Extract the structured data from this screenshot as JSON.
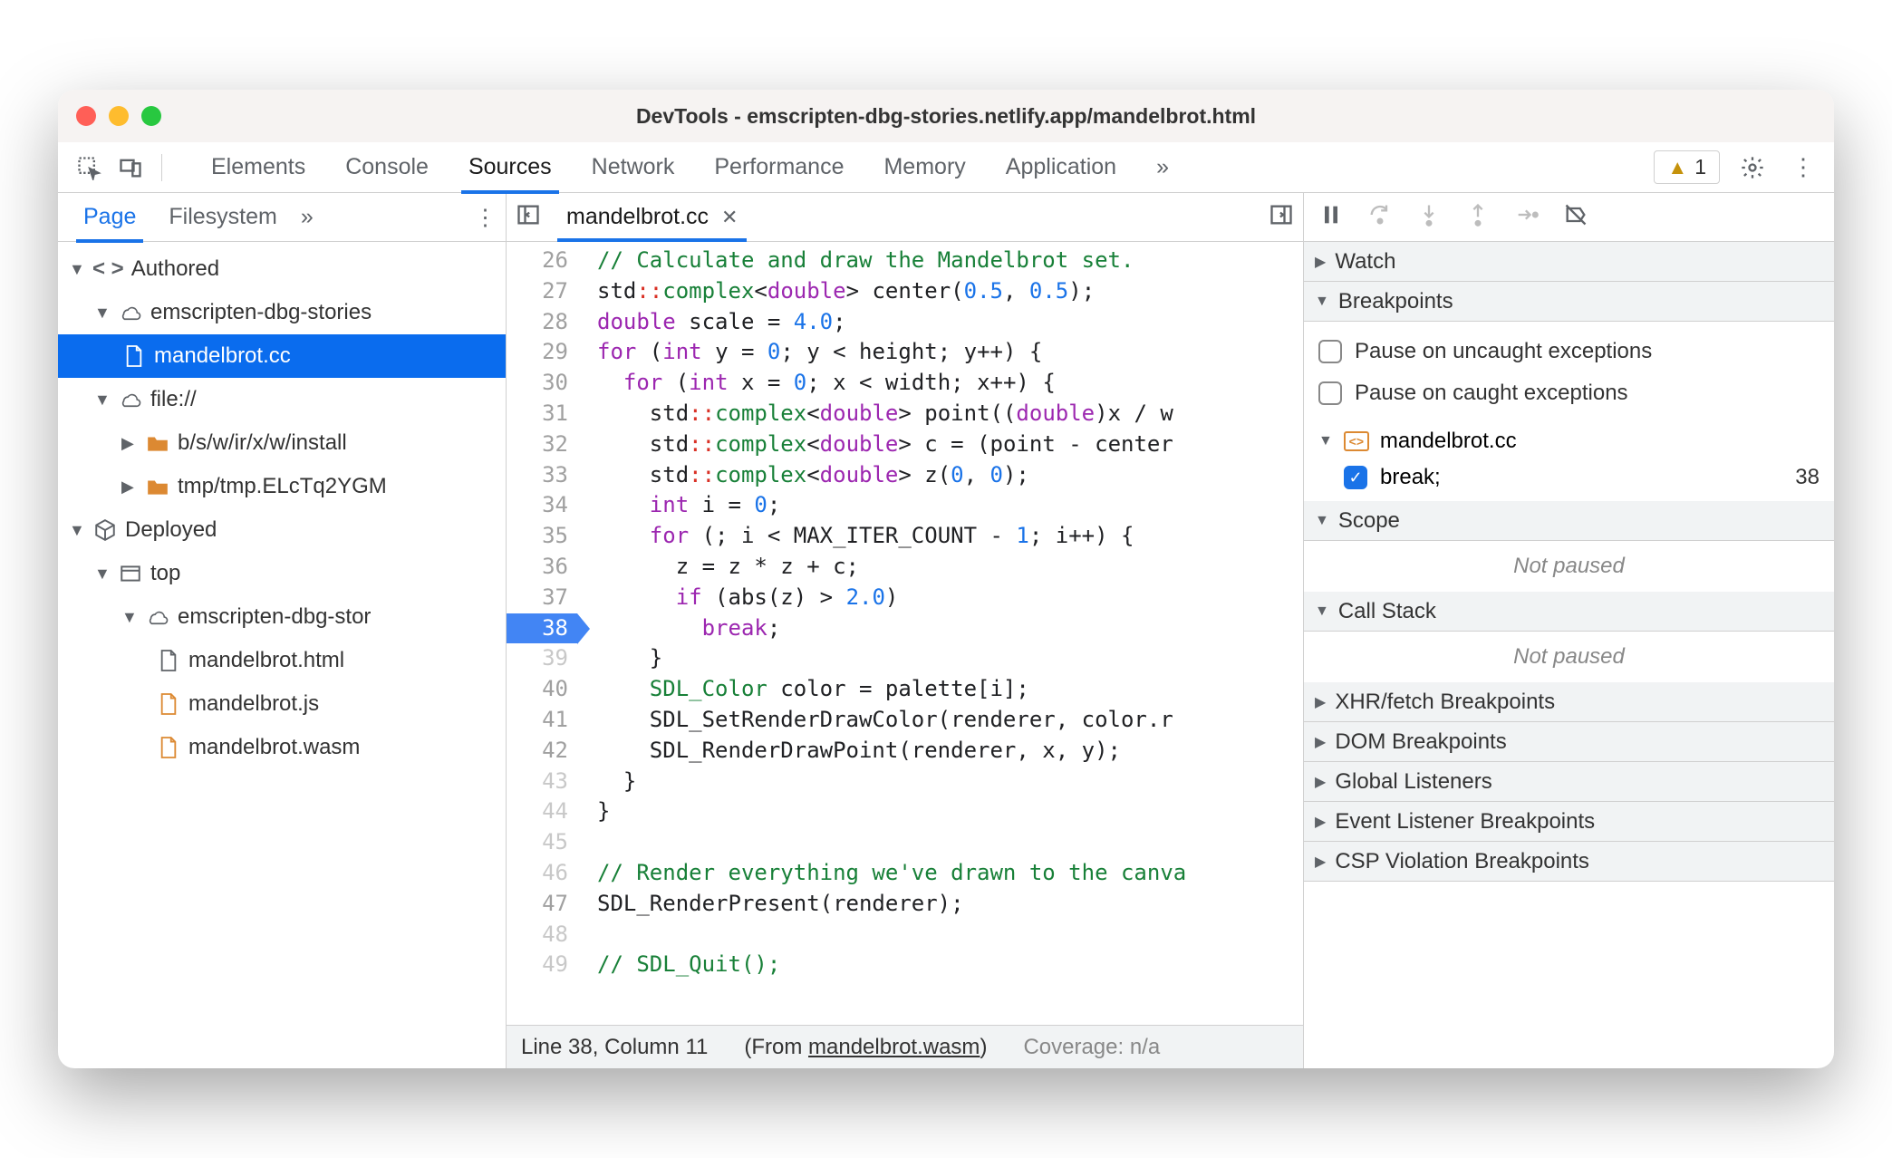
{
  "title": "DevTools - emscripten-dbg-stories.netlify.app/mandelbrot.html",
  "toolbar": {
    "tabs": [
      "Elements",
      "Console",
      "Sources",
      "Network",
      "Performance",
      "Memory",
      "Application"
    ],
    "active": "Sources",
    "overflow": "»",
    "warning_count": "1"
  },
  "nav": {
    "tabs": [
      "Page",
      "Filesystem"
    ],
    "active": "Page",
    "overflow": "»",
    "tree": {
      "authored": "Authored",
      "origin1": "emscripten-dbg-stories",
      "file_selected": "mandelbrot.cc",
      "file_scheme": "file://",
      "folder1": "b/s/w/ir/x/w/install",
      "folder2": "tmp/tmp.ELcTq2YGM",
      "deployed": "Deployed",
      "frame": "top",
      "origin2": "emscripten-dbg-stor",
      "f_html": "mandelbrot.html",
      "f_js": "mandelbrot.js",
      "f_wasm": "mandelbrot.wasm"
    }
  },
  "editor": {
    "tab_name": "mandelbrot.cc",
    "status_pos": "Line 38, Column 11",
    "status_from_prefix": "(From ",
    "status_from_link": "mandelbrot.wasm",
    "status_from_suffix": ")",
    "status_cov": "Coverage: n/a",
    "breakpoint_line": 38,
    "lines": [
      {
        "n": 26,
        "html": "<span class='c-comment'>// Calculate and draw the Mandelbrot set.</span>"
      },
      {
        "n": 27,
        "html": "std<span class='c-prop'>::</span><span class='c-type'>complex</span>&lt;<span class='c-keyword'>double</span>&gt; center(<span class='c-number'>0.5</span>, <span class='c-number'>0.5</span>);"
      },
      {
        "n": 28,
        "html": "<span class='c-keyword'>double</span> scale = <span class='c-number'>4.0</span>;"
      },
      {
        "n": 29,
        "html": "<span class='c-keyword'>for</span> (<span class='c-keyword'>int</span> y = <span class='c-number'>0</span>; y &lt; height; y++) {"
      },
      {
        "n": 30,
        "html": "  <span class='c-keyword'>for</span> (<span class='c-keyword'>int</span> x = <span class='c-number'>0</span>; x &lt; width; x++) {"
      },
      {
        "n": 31,
        "html": "    std<span class='c-prop'>::</span><span class='c-type'>complex</span>&lt;<span class='c-keyword'>double</span>&gt; point((<span class='c-keyword'>double</span>)x / w"
      },
      {
        "n": 32,
        "html": "    std<span class='c-prop'>::</span><span class='c-type'>complex</span>&lt;<span class='c-keyword'>double</span>&gt; c = (point - center"
      },
      {
        "n": 33,
        "html": "    std<span class='c-prop'>::</span><span class='c-type'>complex</span>&lt;<span class='c-keyword'>double</span>&gt; z(<span class='c-number'>0</span>, <span class='c-number'>0</span>);"
      },
      {
        "n": 34,
        "html": "    <span class='c-keyword'>int</span> i = <span class='c-number'>0</span>;"
      },
      {
        "n": 35,
        "html": "    <span class='c-keyword'>for</span> (; i &lt; MAX_ITER_COUNT - <span class='c-number'>1</span>; i++) {"
      },
      {
        "n": 36,
        "html": "      z = z * z + c;"
      },
      {
        "n": 37,
        "html": "      <span class='c-keyword'>if</span> (abs(z) &gt; <span class='c-number'>2.0</span>)"
      },
      {
        "n": 38,
        "html": "        <span class='c-break'>break</span>;"
      },
      {
        "n": 39,
        "html": "    }",
        "faded": true
      },
      {
        "n": 40,
        "html": "    <span class='c-type'>SDL_Color</span> color = palette[i];"
      },
      {
        "n": 41,
        "html": "    SDL_SetRenderDrawColor(renderer, color.r"
      },
      {
        "n": 42,
        "html": "    SDL_RenderDrawPoint(renderer, x, y);"
      },
      {
        "n": 43,
        "html": "  }",
        "faded": true
      },
      {
        "n": 44,
        "html": "}",
        "faded": true
      },
      {
        "n": 45,
        "html": "",
        "faded": true
      },
      {
        "n": 46,
        "html": "<span class='c-comment'>// Render everything we've drawn to the canva</span>",
        "faded": true
      },
      {
        "n": 47,
        "html": "SDL_RenderPresent(renderer);"
      },
      {
        "n": 48,
        "html": "",
        "faded": true
      },
      {
        "n": 49,
        "html": "<span class='c-comment'>// SDL_Quit();</span>",
        "faded": true
      }
    ]
  },
  "right": {
    "watch": "Watch",
    "breakpoints": "Breakpoints",
    "cb_uncaught": "Pause on uncaught exceptions",
    "cb_caught": "Pause on caught exceptions",
    "bp_file": "mandelbrot.cc",
    "bp_text": "break;",
    "bp_line": "38",
    "scope": "Scope",
    "not_paused": "Not paused",
    "callstack": "Call Stack",
    "xhr": "XHR/fetch Breakpoints",
    "dom": "DOM Breakpoints",
    "global": "Global Listeners",
    "event": "Event Listener Breakpoints",
    "csp": "CSP Violation Breakpoints"
  }
}
